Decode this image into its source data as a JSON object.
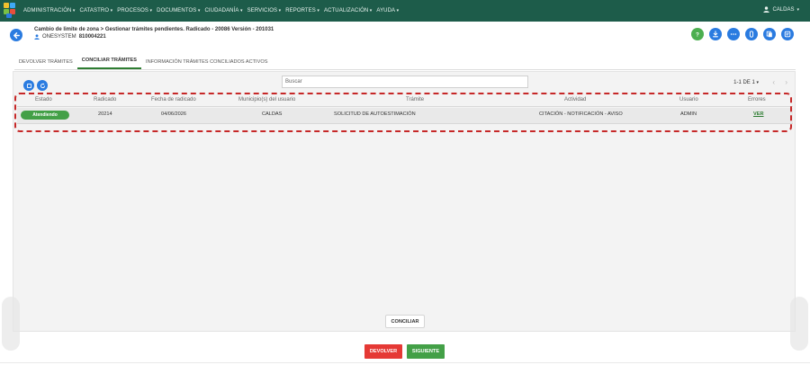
{
  "topbar": {
    "menu": [
      "ADMINISTRACIÓN",
      "CATASTRO",
      "PROCESOS",
      "DOCUMENTOS",
      "CIUDADANÍA",
      "SERVICIOS",
      "REPORTES",
      "ACTUALIZACIÓN",
      "AYUDA"
    ],
    "user": "CALDAS",
    "colors": {
      "bar": "#1d5c4a",
      "text": "#e9f3ef"
    }
  },
  "header": {
    "title": "Cambio de limite de zona > Gestionar trámites pendientes. Radicado - 20086 Versión - 201031",
    "system": "ONESYSTEM",
    "org_id": "810004221",
    "actions": [
      "help-icon",
      "download-icon",
      "more-icon",
      "attachment-icon",
      "copy-icon",
      "notes-icon"
    ]
  },
  "tabs": [
    {
      "label": "DEVOLVER TRÁMITES",
      "active": false
    },
    {
      "label": "CONCILIAR TRÁMITES",
      "active": true
    },
    {
      "label": "INFORMACIÓN TRÁMITES CONCILIADOS ACTIVOS",
      "active": false
    }
  ],
  "toolbar": {
    "search_placeholder": "Buscar",
    "pagination": "1-1 DE 1"
  },
  "table": {
    "columns": [
      "Estado",
      "Radicado",
      "Fecha de radicado",
      "Municipio(s) del usuario",
      "Trámite",
      "Actividad",
      "Usuario",
      "Errores"
    ],
    "rows": [
      {
        "estado": "Atendiendo",
        "radicado": "20214",
        "fecha": "04/06/2026",
        "municipio": "CALDAS",
        "tramite": "SOLICITUD DE AUTOESTIMACIÓN",
        "actividad": "CITACIÓN - NOTIFICACIÓN - AVISO",
        "usuario": "ADMIN",
        "errores": "VER"
      }
    ]
  },
  "buttons": {
    "conciliar": "CONCILIAR",
    "devolver": "DEVOLVER",
    "siguiente": "SIGUIENTE"
  },
  "colors": {
    "primary_blue": "#2a7be0",
    "green": "#43a047",
    "red": "#e53935",
    "highlight": "#c62828"
  }
}
